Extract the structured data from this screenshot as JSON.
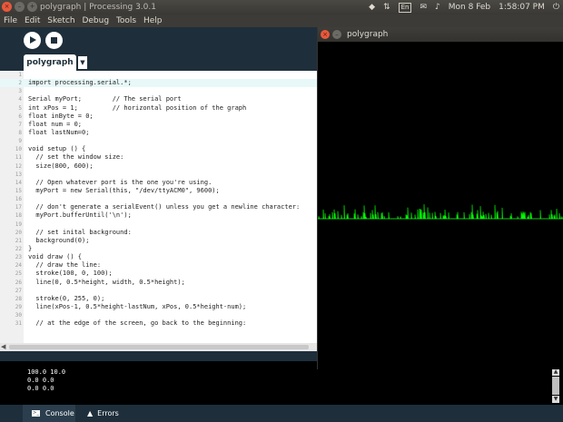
{
  "os_bar": {
    "window_title": "polygraph | Processing 3.0.1",
    "language": "En",
    "date": "Mon 8 Feb",
    "time": "1:58:07 PM",
    "icons": [
      "close-icon",
      "minimize-icon",
      "maximize-icon",
      "dropbox-icon",
      "network-icon",
      "keyboard-icon",
      "mail-icon",
      "volume-icon",
      "power-icon"
    ]
  },
  "menu": [
    "File",
    "Edit",
    "Sketch",
    "Debug",
    "Tools",
    "Help"
  ],
  "editor": {
    "tab_name": "polygraph",
    "tab_menu": "▼",
    "lines": [
      {
        "n": "1",
        "code": ""
      },
      {
        "n": "2",
        "code": "import processing.serial.*;"
      },
      {
        "n": "3",
        "code": ""
      },
      {
        "n": "4",
        "code": "Serial myPort;        // The serial port"
      },
      {
        "n": "5",
        "code": "int xPos = 1;         // horizontal position of the graph"
      },
      {
        "n": "6",
        "code": "float inByte = 0;"
      },
      {
        "n": "7",
        "code": "float num = 0;"
      },
      {
        "n": "8",
        "code": "float lastNum=0;"
      },
      {
        "n": "9",
        "code": ""
      },
      {
        "n": "10",
        "code": "void setup () {"
      },
      {
        "n": "11",
        "code": "  // set the window size:"
      },
      {
        "n": "12",
        "code": "  size(800, 600);"
      },
      {
        "n": "13",
        "code": ""
      },
      {
        "n": "14",
        "code": "  // Open whatever port is the one you're using."
      },
      {
        "n": "15",
        "code": "  myPort = new Serial(this, \"/dev/ttyACM0\", 9600);"
      },
      {
        "n": "16",
        "code": ""
      },
      {
        "n": "17",
        "code": "  // don't generate a serialEvent() unless you get a newline character:"
      },
      {
        "n": "18",
        "code": "  myPort.bufferUntil('\\n');"
      },
      {
        "n": "19",
        "code": ""
      },
      {
        "n": "20",
        "code": "  // set inital background:"
      },
      {
        "n": "21",
        "code": "  background(0);"
      },
      {
        "n": "22",
        "code": "}"
      },
      {
        "n": "23",
        "code": "void draw () {"
      },
      {
        "n": "24",
        "code": "  // draw the line:"
      },
      {
        "n": "25",
        "code": "  stroke(100, 0, 100);"
      },
      {
        "n": "26",
        "code": "  line(0, 0.5*height, width, 0.5*height);"
      },
      {
        "n": "27",
        "code": ""
      },
      {
        "n": "28",
        "code": "  stroke(0, 255, 0);"
      },
      {
        "n": "29",
        "code": "  line(xPos-1, 0.5*height-lastNum, xPos, 0.5*height-num);"
      },
      {
        "n": "30",
        "code": ""
      },
      {
        "n": "31",
        "code": "  // at the edge of the screen, go back to the beginning:"
      }
    ]
  },
  "console": {
    "lines": [
      "100.0 10.0",
      "0.0 0.0",
      "0.0 0.0"
    ]
  },
  "footer": {
    "console_label": "Console",
    "errors_label": "Errors"
  },
  "sketch_window": {
    "title": "polygraph",
    "baseline_color": "#640064",
    "trace_color": "#00ff00",
    "background": "#000000"
  }
}
